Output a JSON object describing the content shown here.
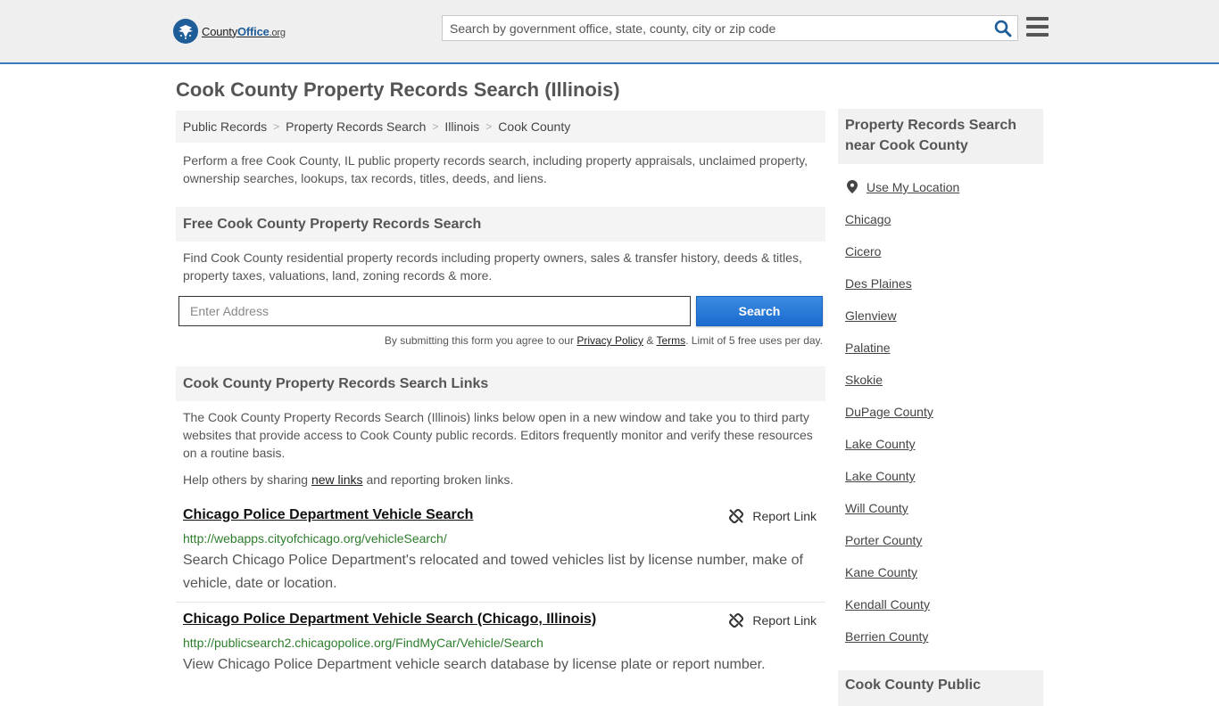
{
  "header": {
    "logo_main": "County",
    "logo_bold": "Office",
    "logo_suffix": ".org",
    "search_placeholder": "Search by government office, state, county, city or zip code"
  },
  "page_title": "Cook County Property Records Search (Illinois)",
  "breadcrumb": [
    "Public Records",
    "Property Records Search",
    "Illinois",
    "Cook County"
  ],
  "intro": "Perform a free Cook County, IL public property records search, including property appraisals, unclaimed property, ownership searches, lookups, tax records, titles, deeds, and liens.",
  "free_search": {
    "heading": "Free Cook County Property Records Search",
    "description": "Find Cook County residential property records including property owners, sales & transfer history, deeds & titles, property taxes, valuations, land, zoning records & more.",
    "address_placeholder": "Enter Address",
    "button_label": "Search",
    "disclaimer_prefix": "By submitting this form you agree to our ",
    "privacy_label": "Privacy Policy",
    "amp": " & ",
    "terms_label": "Terms",
    "disclaimer_suffix": ". Limit of 5 free uses per day."
  },
  "links_section": {
    "heading": "Cook County Property Records Search Links",
    "description": "The Cook County Property Records Search (Illinois) links below open in a new window and take you to third party websites that provide access to Cook County public records. Editors frequently monitor and verify these resources on a routine basis.",
    "help_prefix": "Help others by sharing ",
    "help_link": "new links",
    "help_suffix": " and reporting broken links.",
    "report_label": "Report Link",
    "items": [
      {
        "title": "Chicago Police Department Vehicle Search",
        "url": "http://webapps.cityofchicago.org/vehicleSearch/",
        "description": "Search Chicago Police Department's relocated and towed vehicles list by license number, make of vehicle, date or location."
      },
      {
        "title": "Chicago Police Department Vehicle Search (Chicago, Illinois)",
        "url": "http://publicsearch2.chicagopolice.org/FindMyCar/Vehicle/Search",
        "description": "View Chicago Police Department vehicle search database by license plate or report number."
      }
    ]
  },
  "sidebar": {
    "heading": "Property Records Search near Cook County",
    "use_location": "Use My Location",
    "places": [
      "Chicago",
      "Cicero",
      "Des Plaines",
      "Glenview",
      "Palatine",
      "Skokie",
      "DuPage County",
      "Lake County",
      "Lake County",
      "Will County",
      "Porter County",
      "Kane County",
      "Kendall County",
      "Berrien County"
    ],
    "footer_heading": "Cook County Public"
  },
  "colors": {
    "accent_blue": "#1f5d99",
    "button_blue": "#1a6ad0",
    "url_green": "#2d7d2d"
  }
}
